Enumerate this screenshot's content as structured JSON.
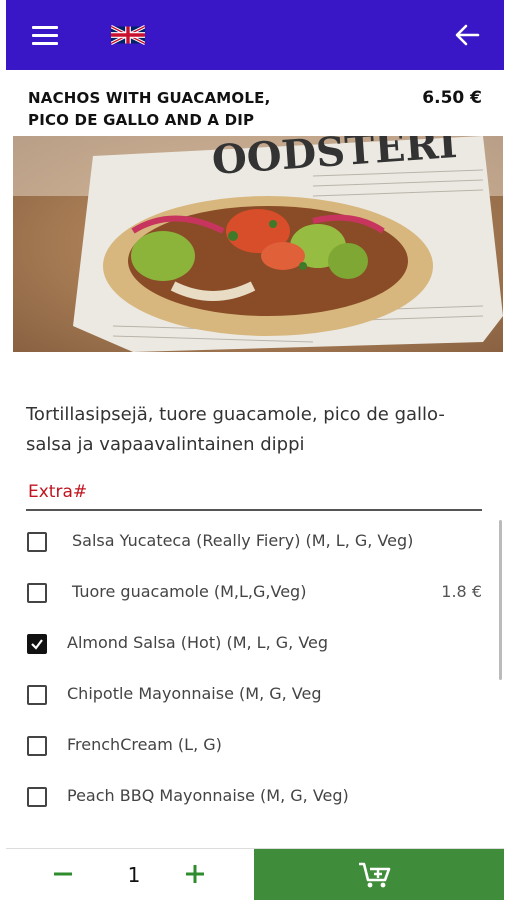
{
  "header": {
    "menu_icon": "hamburger-menu-icon",
    "language_flag_icon": "uk-flag-icon",
    "back_icon": "arrow-left-icon",
    "background_color": "#3a17c6"
  },
  "product": {
    "title_line1": "NACHOS WITH GUACAMOLE,",
    "title_line2": "PICO DE GALLO AND A DIP",
    "price": "6.50 €",
    "description": "Tortillasipsejä, tuore guacamole, pico de gallo-salsa ja vapaavalintainen dippi",
    "photo_newspaper_text": "OODSTERI"
  },
  "extras": {
    "label": "Extra#",
    "label_color": "#c0141f",
    "options": [
      {
        "label": "Salsa Yucateca (Really Fiery) (M, L, G, Veg)",
        "price": "",
        "checked": false
      },
      {
        "label": "Tuore guacamole (M,L,G,Veg)",
        "price": "1.8 €",
        "checked": false
      },
      {
        "label": "Almond Salsa (Hot) (M, L, G, Veg",
        "price": "",
        "checked": true
      },
      {
        "label": "Chipotle Mayonnaise (M, G, Veg",
        "price": "",
        "checked": false
      },
      {
        "label": "FrenchCream (L, G)",
        "price": "",
        "checked": false
      },
      {
        "label": "Peach BBQ Mayonnaise (M, G, Veg)",
        "price": "",
        "checked": false
      }
    ]
  },
  "footer": {
    "quantity": "1",
    "minus_icon": "minus-icon",
    "plus_icon": "plus-icon",
    "cart_icon": "add-to-cart-icon",
    "cart_color": "#3f8d3a",
    "stepper_color": "#2e8b2e"
  }
}
